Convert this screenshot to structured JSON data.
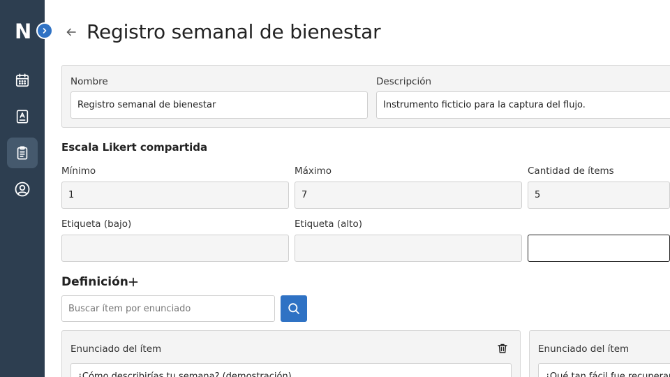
{
  "sidebar": {
    "logo": "N",
    "items": [
      {
        "name": "calendar",
        "icon": "calendar-icon"
      },
      {
        "name": "contacts",
        "icon": "contact-book-icon"
      },
      {
        "name": "questionnaires",
        "icon": "clipboard-icon",
        "active": true
      },
      {
        "name": "profile",
        "icon": "user-circle-icon"
      }
    ]
  },
  "header": {
    "title": "Registro semanal de bienestar"
  },
  "info": {
    "name_label": "Nombre",
    "name_value": "Registro semanal de bienestar",
    "description_label": "Descripción",
    "description_value": "Instrumento ficticio para la captura del flujo."
  },
  "likert": {
    "title": "Escala Likert compartida",
    "min_label": "Mínimo",
    "min_value": "1",
    "max_label": "Máximo",
    "max_value": "7",
    "count_label": "Cantidad de ítems",
    "count_value": "5",
    "low_label": "Etiqueta (bajo)",
    "low_value": "",
    "high_label": "Etiqueta (alto)",
    "high_value": "",
    "extra_value": ""
  },
  "definition": {
    "title": "Definición",
    "search_placeholder": "Buscar ítem por enunciado",
    "items": [
      {
        "label": "Enunciado del ítem",
        "value": "¿Cómo describirías tu semana? (demostración)"
      },
      {
        "label": "Enunciado del ítem",
        "value": "¿Qué tan fácil fue recuperar el ritmo?"
      }
    ]
  },
  "colors": {
    "sidebar": "#2d3e50",
    "accent": "#2f72c4",
    "panel": "#f4f4f4"
  }
}
